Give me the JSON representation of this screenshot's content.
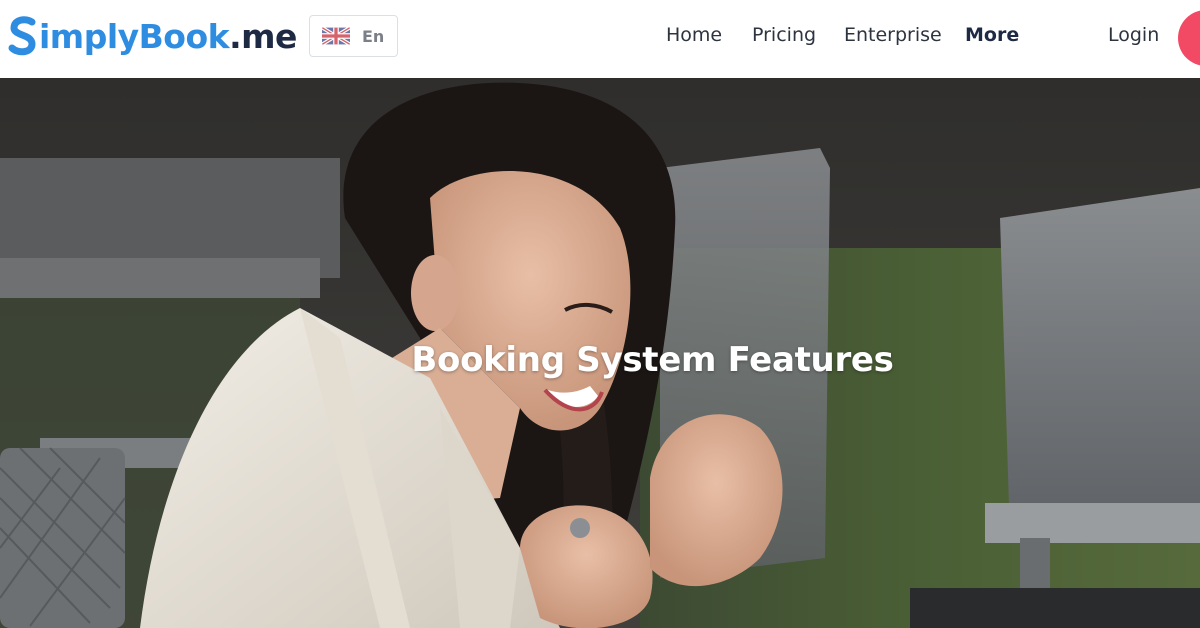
{
  "header": {
    "logo": {
      "initial": "S",
      "word": "implyBook",
      "suffix": ".me"
    },
    "language": {
      "label": "En",
      "flag_icon": "uk-flag-icon"
    },
    "nav": {
      "home": "Home",
      "pricing": "Pricing",
      "enterprise": "Enterprise",
      "more": "More",
      "login": "Login"
    }
  },
  "hero": {
    "title": "Booking System Features"
  },
  "colors": {
    "brand_blue": "#2e8de0",
    "brand_dark": "#1e2a44",
    "cta_pink": "#f24a64",
    "nav_text": "#2d3440"
  }
}
